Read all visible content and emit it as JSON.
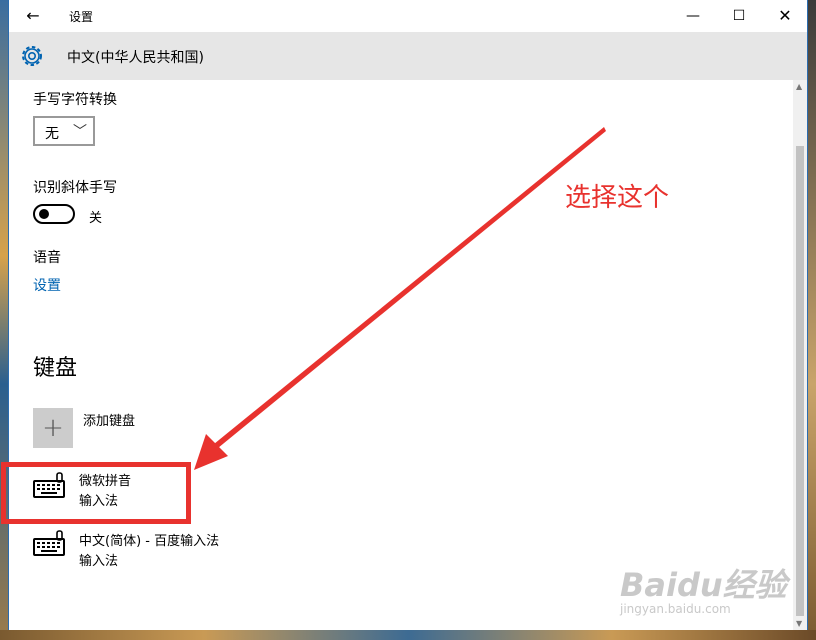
{
  "window": {
    "title": "设置"
  },
  "header": {
    "title": "中文(中华人民共和国)"
  },
  "handwriting": {
    "label": "手写字符转换",
    "dropdown_value": "无"
  },
  "italic": {
    "label": "识别斜体手写",
    "toggle_state": "关"
  },
  "speech": {
    "label": "语音",
    "link": "设置"
  },
  "keyboard": {
    "section_title": "键盘",
    "add_label": "添加键盘",
    "items": [
      {
        "name": "微软拼音",
        "type": "输入法"
      },
      {
        "name": "中文(简体) - 百度输入法",
        "type": "输入法"
      }
    ]
  },
  "annotation": {
    "text": "选择这个",
    "color": "#e8322e"
  },
  "watermark": {
    "logo": "Baidu经验",
    "url": "jingyan.baidu.com"
  },
  "colors": {
    "link": "#0063b1",
    "annotation": "#e8322e"
  }
}
